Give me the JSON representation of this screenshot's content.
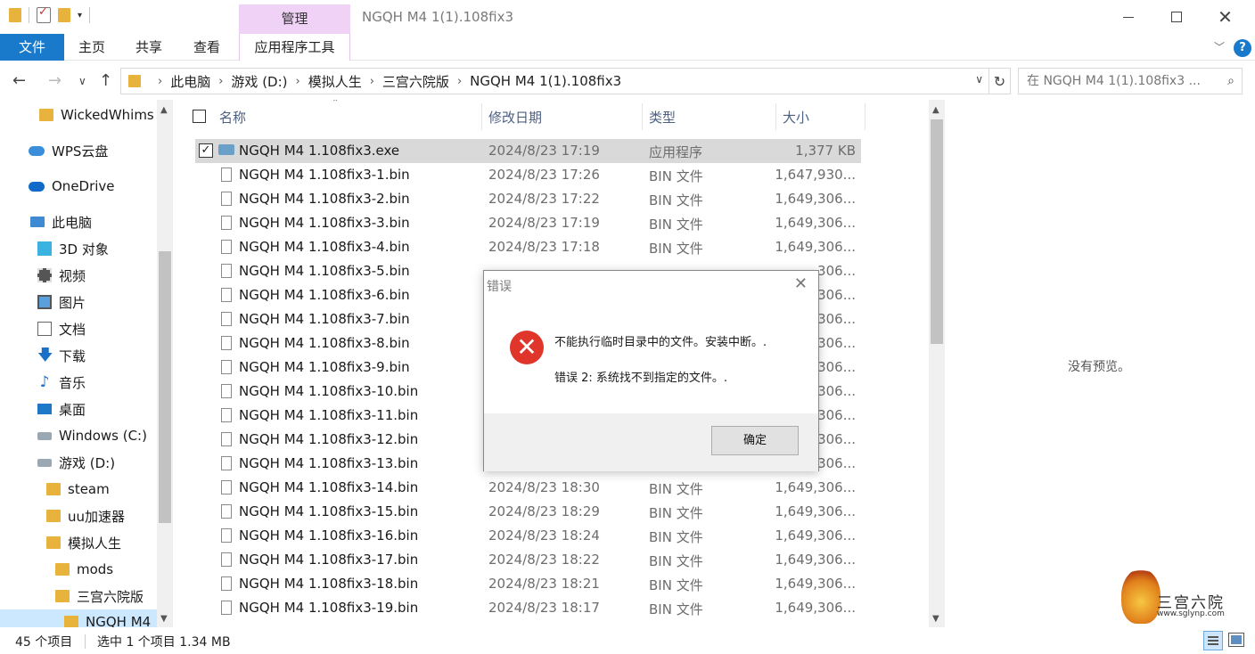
{
  "window": {
    "title": "NGQH M4 1(1).108fix3",
    "context_tab_group": "管理",
    "close_glyph": "✕"
  },
  "ribbon": {
    "tabs": [
      "文件",
      "主页",
      "共享",
      "查看",
      "应用程序工具"
    ],
    "accent": "#1979ca",
    "context_color": "#efd2f6"
  },
  "address": {
    "breadcrumbs": [
      "此电脑",
      "游戏 (D:)",
      "模拟人生",
      "三宫六院版",
      "NGQH M4 1(1).108fix3"
    ],
    "search_placeholder": "在 NGQH M4 1(1).108fix3 ..."
  },
  "navpane": {
    "items": [
      {
        "label": "WickedWhims v",
        "icon": "folder-icon"
      },
      {
        "label": "WPS云盘",
        "icon": "cloud-icon"
      },
      {
        "label": "OneDrive",
        "icon": "onedrive-icon"
      },
      {
        "label": "此电脑",
        "icon": "pc-icon"
      },
      {
        "label": "3D 对象",
        "icon": "cube-icon"
      },
      {
        "label": "视频",
        "icon": "video-icon"
      },
      {
        "label": "图片",
        "icon": "picture-icon"
      },
      {
        "label": "文档",
        "icon": "document-icon"
      },
      {
        "label": "下载",
        "icon": "download-icon"
      },
      {
        "label": "音乐",
        "icon": "music-icon"
      },
      {
        "label": "桌面",
        "icon": "desktop-icon"
      },
      {
        "label": "Windows (C:)",
        "icon": "drive-icon"
      },
      {
        "label": "游戏 (D:)",
        "icon": "drive-icon"
      },
      {
        "label": "steam",
        "icon": "folder-icon"
      },
      {
        "label": "uu加速器",
        "icon": "folder-icon"
      },
      {
        "label": "模拟人生",
        "icon": "folder-icon"
      },
      {
        "label": "mods",
        "icon": "folder-icon"
      },
      {
        "label": "三宫六院版",
        "icon": "folder-icon"
      },
      {
        "label": "NGQH M4",
        "icon": "folder-icon"
      }
    ]
  },
  "filelist": {
    "columns": [
      "名称",
      "修改日期",
      "类型",
      "大小"
    ],
    "rows": [
      {
        "name": "NGQH M4 1.108fix3.exe",
        "date": "2024/8/23 17:19",
        "type": "应用程序",
        "size": "1,377 KB",
        "selected": true,
        "kind": "exe"
      },
      {
        "name": "NGQH M4 1.108fix3-1.bin",
        "date": "2024/8/23 17:26",
        "type": "BIN 文件",
        "size": "1,647,930..."
      },
      {
        "name": "NGQH M4 1.108fix3-2.bin",
        "date": "2024/8/23 17:22",
        "type": "BIN 文件",
        "size": "1,649,306..."
      },
      {
        "name": "NGQH M4 1.108fix3-3.bin",
        "date": "2024/8/23 17:19",
        "type": "BIN 文件",
        "size": "1,649,306..."
      },
      {
        "name": "NGQH M4 1.108fix3-4.bin",
        "date": "2024/8/23 17:18",
        "type": "BIN 文件",
        "size": "1,649,306..."
      },
      {
        "name": "NGQH M4 1.108fix3-5.bin",
        "date": "",
        "type": "",
        "size": "...306..."
      },
      {
        "name": "NGQH M4 1.108fix3-6.bin",
        "date": "",
        "type": "",
        "size": "306..."
      },
      {
        "name": "NGQH M4 1.108fix3-7.bin",
        "date": "",
        "type": "",
        "size": "306..."
      },
      {
        "name": "NGQH M4 1.108fix3-8.bin",
        "date": "",
        "type": "",
        "size": "306..."
      },
      {
        "name": "NGQH M4 1.108fix3-9.bin",
        "date": "",
        "type": "",
        "size": "306..."
      },
      {
        "name": "NGQH M4 1.108fix3-10.bin",
        "date": "",
        "type": "",
        "size": "306..."
      },
      {
        "name": "NGQH M4 1.108fix3-11.bin",
        "date": "",
        "type": "",
        "size": "306..."
      },
      {
        "name": "NGQH M4 1.108fix3-12.bin",
        "date": "",
        "type": "",
        "size": "306..."
      },
      {
        "name": "NGQH M4 1.108fix3-13.bin",
        "date": "",
        "type": "",
        "size": "306..."
      },
      {
        "name": "NGQH M4 1.108fix3-14.bin",
        "date": "2024/8/23 18:30",
        "type": "BIN 文件",
        "size": "1,649,306..."
      },
      {
        "name": "NGQH M4 1.108fix3-15.bin",
        "date": "2024/8/23 18:29",
        "type": "BIN 文件",
        "size": "1,649,306..."
      },
      {
        "name": "NGQH M4 1.108fix3-16.bin",
        "date": "2024/8/23 18:24",
        "type": "BIN 文件",
        "size": "1,649,306..."
      },
      {
        "name": "NGQH M4 1.108fix3-17.bin",
        "date": "2024/8/23 18:22",
        "type": "BIN 文件",
        "size": "1,649,306..."
      },
      {
        "name": "NGQH M4 1.108fix3-18.bin",
        "date": "2024/8/23 18:21",
        "type": "BIN 文件",
        "size": "1,649,306..."
      },
      {
        "name": "NGQH M4 1.108fix3-19.bin",
        "date": "2024/8/23 18:17",
        "type": "BIN 文件",
        "size": "1,649,306..."
      }
    ]
  },
  "preview": {
    "empty_text": "没有预览。"
  },
  "status": {
    "count": "45 个项目",
    "selection": "选中 1 个项目  1.34 MB"
  },
  "dialog": {
    "title": "错误",
    "message": "不能执行临时目录中的文件。安装中断。.",
    "detail": "错误 2: 系统找不到指定的文件。.",
    "ok_label": "确定",
    "icon": "error-icon",
    "icon_color": "#e0352b"
  },
  "watermark": {
    "text": "三宫六院",
    "url": "www.sglynp.com"
  }
}
